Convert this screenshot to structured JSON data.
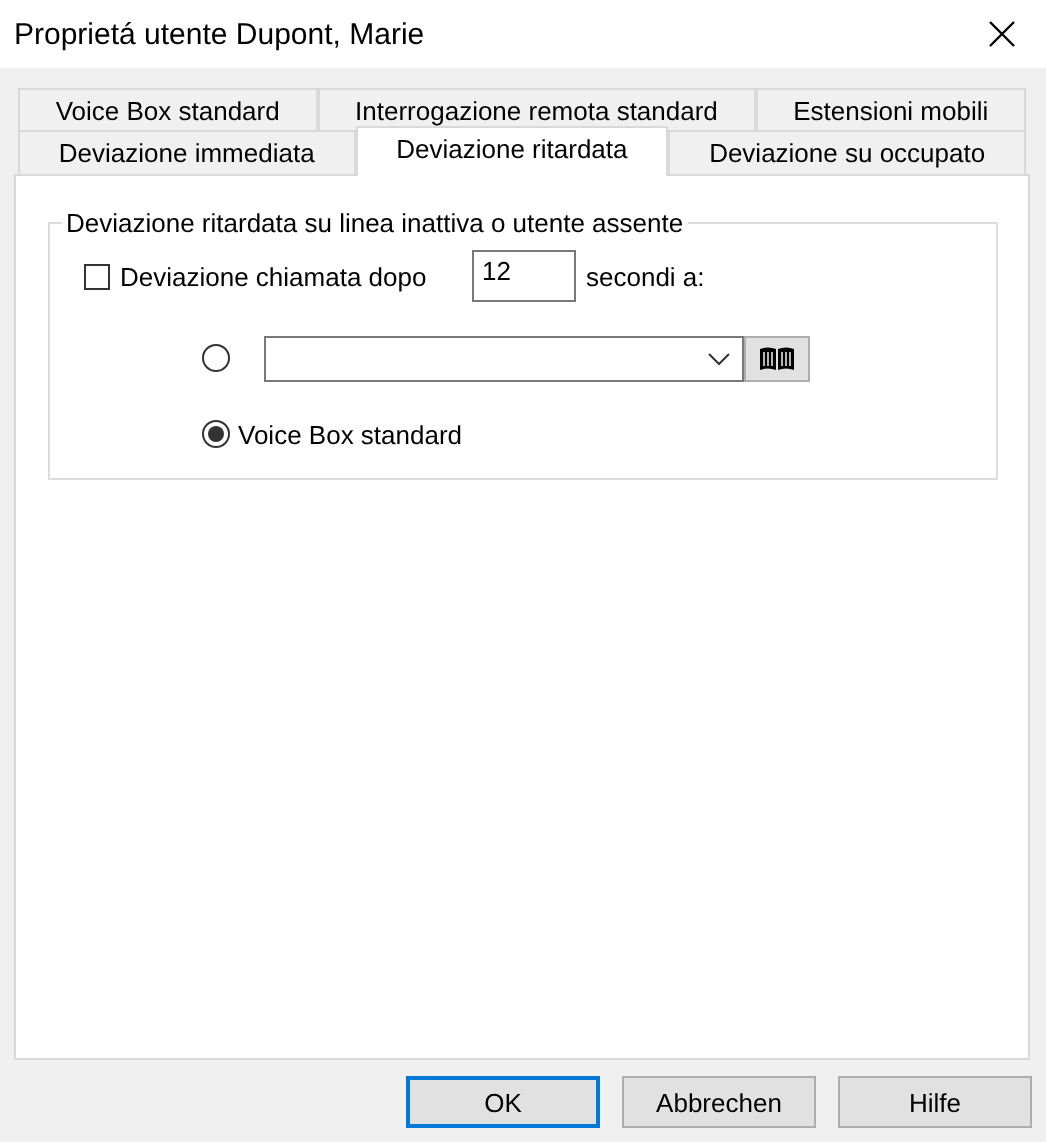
{
  "window": {
    "title": "Proprietá utente Dupont, Marie"
  },
  "tabs": [
    [
      {
        "label": "Voice Box standard",
        "selected": false
      },
      {
        "label": "Interrogazione remota standard",
        "selected": false
      },
      {
        "label": "Estensioni mobili",
        "selected": false
      }
    ],
    [
      {
        "label": "Deviazione immediata",
        "selected": false
      },
      {
        "label": "Deviazione ritardata",
        "selected": true
      },
      {
        "label": "Deviazione su occupato",
        "selected": false
      }
    ]
  ],
  "group": {
    "title": "Deviazione ritardata su linea inattiva o utente assente",
    "forward": {
      "label": "Deviazione chiamata dopo",
      "checked": false
    },
    "seconds": {
      "value": "12"
    },
    "seconds_label": "secondi a:",
    "options": [
      {
        "kind": "combo",
        "selected": false
      },
      {
        "kind": "label",
        "label": "Voice Box standard",
        "selected": true
      }
    ]
  },
  "buttons": [
    {
      "label": "OK",
      "default": true
    },
    {
      "label": "Abbrechen",
      "default": false
    },
    {
      "label": "Hilfe",
      "default": false
    }
  ]
}
